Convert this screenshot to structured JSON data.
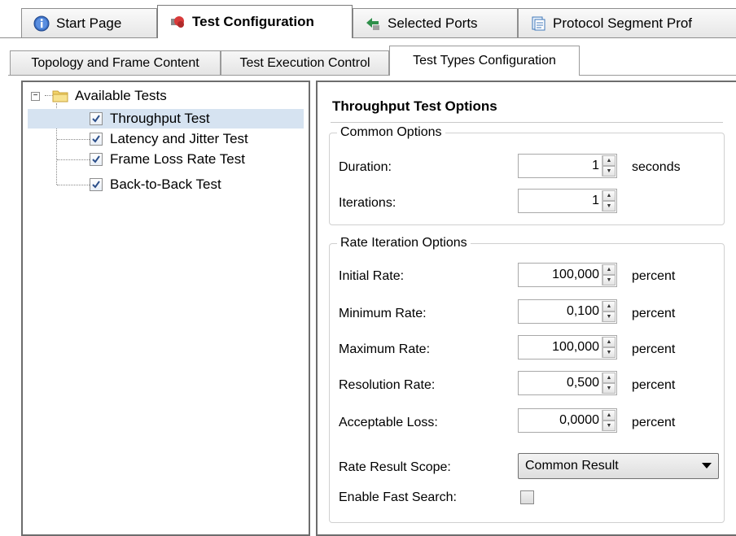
{
  "doc_tabs": [
    {
      "label": "Start Page",
      "icon": "info-icon"
    },
    {
      "label": "Test Configuration",
      "icon": "test-configuration-icon"
    },
    {
      "label": "Selected Ports",
      "icon": "ports-icon"
    },
    {
      "label": "Protocol Segment Prof",
      "icon": "document-icon"
    }
  ],
  "sub_tabs": [
    {
      "label": "Topology and Frame Content"
    },
    {
      "label": "Test Execution Control"
    },
    {
      "label": "Test Types Configuration"
    }
  ],
  "tree": {
    "root": "Available Tests",
    "items": [
      {
        "label": "Throughput Test",
        "checked": true,
        "selected": true
      },
      {
        "label": "Latency and Jitter Test",
        "checked": true
      },
      {
        "label": "Frame Loss Rate Test",
        "checked": true
      },
      {
        "label": "Back-to-Back Test",
        "checked": true
      }
    ]
  },
  "options": {
    "title": "Throughput Test Options",
    "common": {
      "legend": "Common Options",
      "duration_label": "Duration:",
      "duration_value": "1",
      "duration_unit": "seconds",
      "iterations_label": "Iterations:",
      "iterations_value": "1"
    },
    "rate": {
      "legend": "Rate Iteration Options",
      "fields": [
        {
          "label": "Initial Rate:",
          "value": "100,000",
          "unit": "percent"
        },
        {
          "label": "Minimum Rate:",
          "value": "0,100",
          "unit": "percent"
        },
        {
          "label": "Maximum Rate:",
          "value": "100,000",
          "unit": "percent"
        },
        {
          "label": "Resolution Rate:",
          "value": "0,500",
          "unit": "percent"
        },
        {
          "label": "Acceptable Loss:",
          "value": "0,0000",
          "unit": "percent"
        }
      ],
      "scope_label": "Rate Result Scope:",
      "scope_value": "Common Result",
      "fast_search_label": "Enable Fast Search:",
      "fast_search_checked": false
    }
  },
  "colors": {
    "selection": "#d6e3f1",
    "check_blue": "#2c4f8a"
  }
}
